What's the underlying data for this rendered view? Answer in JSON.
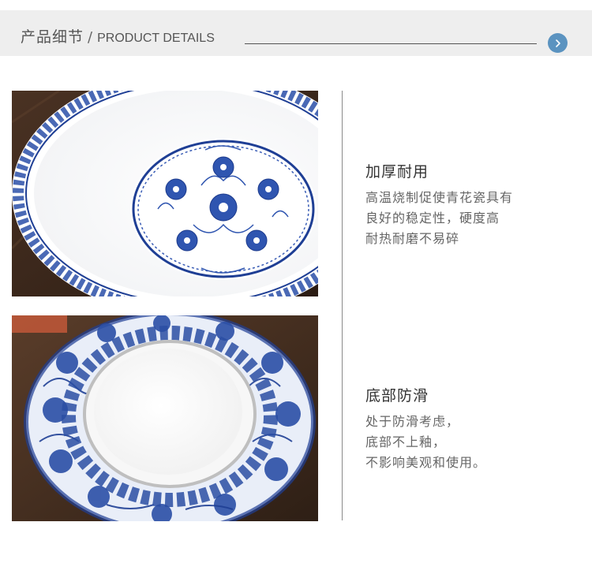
{
  "header": {
    "title_cn": "产品细节",
    "separator": "/",
    "title_en": "PRODUCT DETAILS",
    "next_icon": "chevron-right-icon",
    "accent_color": "#5b93c0",
    "bar_color": "#eeeeee"
  },
  "images": [
    {
      "name": "bowl-interior-photo",
      "subject": "blue-and-white porcelain bowl interior, floral medallion"
    },
    {
      "name": "bowl-base-photo",
      "subject": "blue-and-white porcelain bowl turned over, unglazed base"
    }
  ],
  "features": [
    {
      "title": "加厚耐用",
      "lines": [
        "高温烧制促使青花瓷具有",
        "良好的稳定性，硬度高",
        "耐热耐磨不易碎"
      ]
    },
    {
      "title": "底部防滑",
      "lines": [
        "处于防滑考虑，",
        "底部不上釉，",
        "不影响美观和使用。"
      ]
    }
  ]
}
